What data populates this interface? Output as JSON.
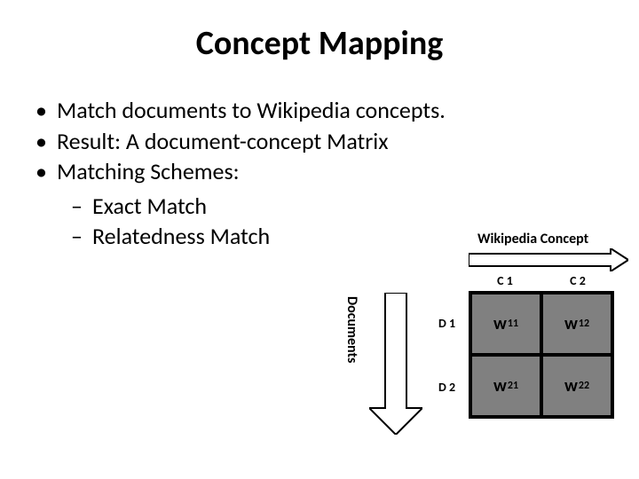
{
  "title": "Concept Mapping",
  "bullets": [
    "Match documents to Wikipedia concepts.",
    "Result: A document-concept Matrix",
    "Matching Schemes:"
  ],
  "sub_bullets": [
    "Exact Match",
    "Relatedness Match"
  ],
  "diagram": {
    "concept_axis_label": "Wikipedia Concept",
    "document_axis_label": "Documents",
    "col_headers": [
      "C 1",
      "C 2"
    ],
    "row_headers": [
      "D 1",
      "D 2"
    ],
    "cells": {
      "r1c1": {
        "base": "w",
        "sub": "11"
      },
      "r1c2": {
        "base": "w",
        "sub": "12"
      },
      "r2c1": {
        "base": "w",
        "sub": "21"
      },
      "r2c2": {
        "base": "w",
        "sub": "22"
      }
    }
  }
}
